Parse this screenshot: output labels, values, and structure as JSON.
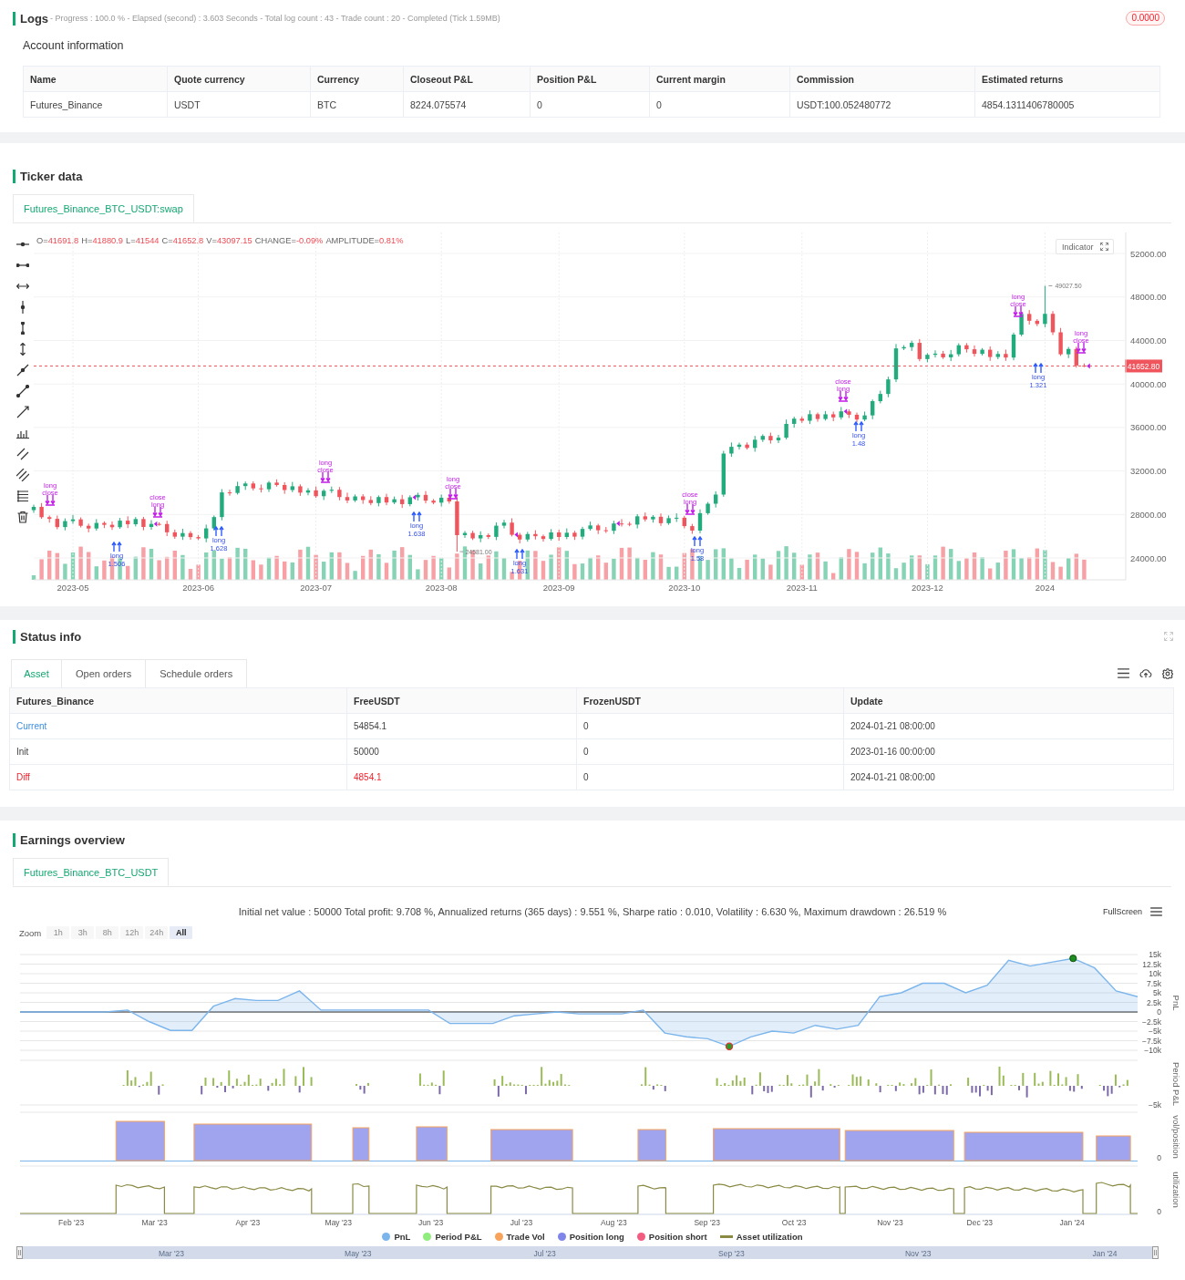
{
  "logs": {
    "title": "Logs",
    "summary": "- Progress : 100.0 % - Elapsed (second) : 3.603 Seconds - Total log count : 43 - Trade count : 20 - Completed (Tick 1.59MB)",
    "badge": "0.0000"
  },
  "account": {
    "title": "Account information",
    "columns": [
      "Name",
      "Quote currency",
      "Currency",
      "Closeout P&L",
      "Position P&L",
      "Current margin",
      "Commission",
      "Estimated returns"
    ],
    "rows": [
      [
        "Futures_Binance",
        "USDT",
        "BTC",
        "8224.075574",
        "0",
        "0",
        "USDT:100.052480772",
        "4854.1311406780005"
      ]
    ]
  },
  "ticker": {
    "title": "Ticker data",
    "tabs": [
      {
        "label": "Futures_Binance_BTC_USDT:swap",
        "selected": true
      }
    ],
    "ohlc_legend": [
      {
        "label": "O=",
        "value": "41691.8"
      },
      {
        "label": "H=",
        "value": "41880.9"
      },
      {
        "label": "L=",
        "value": "41544"
      },
      {
        "label": "C=",
        "value": "41652.8"
      },
      {
        "label": "V=",
        "value": "43097.15"
      },
      {
        "label": "CHANGE=",
        "value": "-0.09%"
      },
      {
        "label": "AMPLITUDE=",
        "value": "0.81%"
      }
    ],
    "indicator": "Indicator",
    "last_price": "41652.80",
    "high_label": "49027.50",
    "low_label": "24581.00",
    "chart_data": {
      "type": "candlestick",
      "grid": true,
      "categories": [
        null,
        null,
        null,
        null,
        null,
        "2023-05",
        null,
        null,
        null,
        null,
        null,
        null,
        null,
        null,
        null,
        null,
        null,
        null,
        null,
        null,
        null,
        "2023-06",
        null,
        null,
        null,
        null,
        null,
        null,
        null,
        null,
        null,
        null,
        null,
        null,
        null,
        null,
        "2023-07",
        null,
        null,
        null,
        null,
        null,
        null,
        null,
        null,
        null,
        null,
        null,
        null,
        null,
        null,
        null,
        "2023-08",
        null,
        null,
        null,
        null,
        null,
        null,
        null,
        null,
        null,
        null,
        null,
        null,
        null,
        null,
        "2023-09",
        null,
        null,
        null,
        null,
        null,
        null,
        null,
        null,
        null,
        null,
        null,
        null,
        null,
        null,
        null,
        "2023-10",
        null,
        null,
        null,
        null,
        null,
        null,
        null,
        null,
        null,
        null,
        null,
        null,
        null,
        null,
        "2023-11",
        null,
        null,
        null,
        null,
        null,
        null,
        null,
        null,
        null,
        null,
        null,
        null,
        null,
        null,
        null,
        "2023-12",
        null,
        null,
        null,
        null,
        null,
        null,
        null,
        null,
        null,
        null,
        null,
        null,
        null,
        null,
        "2024",
        null,
        null,
        null,
        null,
        null
      ],
      "ohlc": [
        [
          28400,
          28900,
          28150,
          28700
        ],
        [
          28700,
          29050,
          27600,
          27750
        ],
        [
          27750,
          27900,
          27250,
          27600
        ],
        [
          27600,
          27900,
          26640,
          26840
        ],
        [
          26840,
          27640,
          26540,
          27390
        ],
        [
          27390,
          27950,
          27140,
          27550
        ],
        [
          27550,
          27730,
          26810,
          26960
        ],
        [
          26960,
          27160,
          26360,
          26710
        ],
        [
          26710,
          27570,
          26510,
          27220
        ],
        [
          27220,
          27370,
          26750,
          27050
        ],
        [
          27050,
          27350,
          26580,
          26830
        ],
        [
          26830,
          27680,
          26680,
          27430
        ],
        [
          27430,
          27830,
          26750,
          27100
        ],
        [
          27100,
          27760,
          26900,
          27580
        ],
        [
          27580,
          27780,
          26550,
          26850
        ],
        [
          26850,
          27480,
          26600,
          27130
        ],
        [
          27130,
          27280,
          26970,
          27120
        ],
        [
          27120,
          27420,
          26010,
          26360
        ],
        [
          26360,
          26610,
          25760,
          25960
        ],
        [
          25960,
          26690,
          25660,
          26290
        ],
        [
          26290,
          26470,
          25670,
          25920
        ],
        [
          25920,
          26120,
          25650,
          25800
        ],
        [
          25800,
          27070,
          25450,
          26720
        ],
        [
          26720,
          27910,
          26520,
          27760
        ],
        [
          27760,
          30330,
          27460,
          30030
        ],
        [
          30030,
          30280,
          29730,
          29980
        ],
        [
          29980,
          31010,
          29830,
          30610
        ],
        [
          30610,
          31030,
          30260,
          30850
        ],
        [
          30850,
          31050,
          30200,
          30400
        ],
        [
          30400,
          30750,
          30020,
          30320
        ],
        [
          30320,
          31080,
          30070,
          30930
        ],
        [
          30930,
          31230,
          30560,
          30710
        ],
        [
          30710,
          30960,
          29900,
          30250
        ],
        [
          30250,
          30990,
          30050,
          30590
        ],
        [
          30590,
          30770,
          29710,
          30010
        ],
        [
          30010,
          30420,
          29760,
          30220
        ],
        [
          30220,
          30570,
          29530,
          29680
        ],
        [
          29680,
          30330,
          29330,
          30180
        ],
        [
          30180,
          30570,
          29980,
          30270
        ],
        [
          30270,
          30520,
          29300,
          29600
        ],
        [
          29600,
          30000,
          29040,
          29290
        ],
        [
          29290,
          29840,
          29140,
          29660
        ],
        [
          29660,
          29860,
          28980,
          29330
        ],
        [
          29330,
          29680,
          28850,
          29050
        ],
        [
          29050,
          29750,
          28750,
          29600
        ],
        [
          29600,
          29900,
          28850,
          29100
        ],
        [
          29100,
          29650,
          28950,
          29400
        ],
        [
          29400,
          29800,
          28600,
          28950
        ],
        [
          28950,
          29760,
          28750,
          29580
        ],
        [
          29580,
          30000,
          29280,
          29800
        ],
        [
          29800,
          30150,
          29020,
          29270
        ],
        [
          29270,
          29420,
          28940,
          29090
        ],
        [
          29090,
          29840,
          28740,
          29540
        ],
        [
          29540,
          29790,
          29000,
          29200
        ],
        [
          29200,
          29600,
          24581,
          26100
        ],
        [
          26100,
          26480,
          25850,
          26300
        ],
        [
          26300,
          26500,
          25650,
          25800
        ],
        [
          25800,
          26450,
          25450,
          26100
        ],
        [
          26100,
          26250,
          25740,
          25940
        ],
        [
          25940,
          27270,
          25640,
          26970
        ],
        [
          26970,
          27500,
          26720,
          27250
        ],
        [
          27250,
          27650,
          25980,
          26130
        ],
        [
          26130,
          26310,
          25350,
          25700
        ],
        [
          25700,
          26400,
          25500,
          26200
        ],
        [
          26200,
          26550,
          25700,
          26000
        ],
        [
          26000,
          26150,
          25500,
          25750
        ],
        [
          25750,
          26650,
          25600,
          26350
        ],
        [
          26350,
          26600,
          25580,
          25930
        ],
        [
          25930,
          26720,
          25730,
          26320
        ],
        [
          26320,
          26500,
          25660,
          25960
        ],
        [
          25960,
          26870,
          25710,
          26670
        ],
        [
          26670,
          27340,
          26520,
          26990
        ],
        [
          26990,
          27140,
          26200,
          26550
        ],
        [
          26550,
          26850,
          26300,
          26500
        ],
        [
          26500,
          27420,
          26200,
          27170
        ],
        [
          27170,
          27570,
          26890,
          27140
        ],
        [
          27140,
          27320,
          26920,
          27070
        ],
        [
          27070,
          28030,
          26720,
          27830
        ],
        [
          27830,
          28180,
          27350,
          27550
        ],
        [
          27550,
          27940,
          27250,
          27790
        ],
        [
          27790,
          28090,
          26950,
          27200
        ],
        [
          27200,
          27910,
          27050,
          27660
        ],
        [
          27660,
          28100,
          27310,
          27700
        ],
        [
          27700,
          27880,
          26730,
          26930
        ],
        [
          26930,
          27130,
          26220,
          26520
        ],
        [
          26520,
          28470,
          26270,
          28120
        ],
        [
          28120,
          29140,
          27970,
          28990
        ],
        [
          28990,
          30130,
          28640,
          29830
        ],
        [
          29830,
          33850,
          29630,
          33600
        ],
        [
          33600,
          34620,
          33300,
          34220
        ],
        [
          34220,
          34600,
          33970,
          34420
        ],
        [
          34420,
          34620,
          33970,
          34120
        ],
        [
          34120,
          35220,
          33770,
          34870
        ],
        [
          34870,
          35370,
          34670,
          35220
        ],
        [
          35220,
          35520,
          34520,
          34820
        ],
        [
          34820,
          35310,
          34570,
          35060
        ],
        [
          35060,
          36730,
          34910,
          36330
        ],
        [
          36330,
          36990,
          35980,
          36810
        ],
        [
          36810,
          37010,
          36420,
          36620
        ],
        [
          36620,
          37570,
          36320,
          37220
        ],
        [
          37220,
          37370,
          36530,
          36780
        ],
        [
          36780,
          37510,
          36630,
          37210
        ],
        [
          37210,
          37460,
          36580,
          36930
        ],
        [
          36930,
          37880,
          36730,
          37480
        ],
        [
          37480,
          37660,
          36870,
          37170
        ],
        [
          37170,
          37370,
          36480,
          36730
        ],
        [
          36730,
          37460,
          36580,
          37110
        ],
        [
          37110,
          38570,
          36760,
          38420
        ],
        [
          38420,
          39380,
          38220,
          39080
        ],
        [
          39080,
          40670,
          38780,
          40420
        ],
        [
          40420,
          43670,
          40170,
          43270
        ],
        [
          43270,
          43570,
          43120,
          43390
        ],
        [
          43390,
          43980,
          43040,
          43780
        ],
        [
          43780,
          44130,
          42090,
          42290
        ],
        [
          42290,
          42830,
          41990,
          42680
        ],
        [
          42680,
          43090,
          42430,
          42790
        ],
        [
          42790,
          43040,
          42300,
          42450
        ],
        [
          42450,
          43130,
          42100,
          42730
        ],
        [
          42730,
          43740,
          42530,
          43560
        ],
        [
          43560,
          43760,
          42890,
          43190
        ],
        [
          43190,
          43540,
          42520,
          42770
        ],
        [
          42770,
          43300,
          42620,
          43150
        ],
        [
          43150,
          43450,
          42130,
          42480
        ],
        [
          42480,
          43010,
          42280,
          42760
        ],
        [
          42760,
          43160,
          42130,
          42430
        ],
        [
          42430,
          44720,
          42180,
          44540
        ],
        [
          44540,
          46640,
          44390,
          46440
        ],
        [
          46440,
          46790,
          45460,
          45810
        ],
        [
          45810,
          45960,
          45320,
          45520
        ],
        [
          45520,
          49027.5,
          45220,
          46450
        ],
        [
          46450,
          46700,
          44500,
          44750
        ],
        [
          44750,
          45150,
          42580,
          42730
        ],
        [
          42730,
          43400,
          42380,
          43220
        ],
        [
          43220,
          43420,
          41500,
          41700
        ],
        [
          41691.8,
          41880.9,
          41544,
          41652.8
        ]
      ],
      "ylim": [
        21990,
        53930
      ],
      "yticks": [
        {
          "value": 52000,
          "label": "52000.00"
        },
        {
          "value": 48000,
          "label": "48000.00"
        },
        {
          "value": 44000,
          "label": "44000.00"
        },
        {
          "value": 40000,
          "label": "40000.00"
        },
        {
          "value": 36000,
          "label": "36000.00"
        },
        {
          "value": 32000,
          "label": "32000.00"
        },
        {
          "value": 28000,
          "label": "28000.00"
        },
        {
          "value": 24000,
          "label": "24000.00"
        }
      ]
    },
    "markers": [
      {
        "kind": "exit",
        "lines": [
          "long",
          "close"
        ]
      },
      {
        "kind": "entry",
        "lines": [
          "long",
          "1.506"
        ]
      },
      {
        "kind": "exit",
        "lines": [
          "close",
          "long"
        ]
      },
      {
        "kind": "entry",
        "lines": [
          "long",
          "1.628"
        ]
      },
      {
        "kind": "exit",
        "lines": [
          "long",
          "close"
        ]
      },
      {
        "kind": "entry",
        "lines": [
          "long",
          "1.638"
        ]
      },
      {
        "kind": "exit",
        "lines": [
          "long",
          "close"
        ]
      },
      {
        "kind": "entry",
        "lines": [
          "long",
          "1.631"
        ]
      },
      {
        "kind": "exit",
        "lines": [
          "close",
          "long"
        ]
      },
      {
        "kind": "entry",
        "lines": [
          "long",
          "1.58"
        ]
      },
      {
        "kind": "exit",
        "lines": [
          "close",
          "long"
        ]
      },
      {
        "kind": "entry",
        "lines": [
          "long",
          "1.48"
        ]
      },
      {
        "kind": "exit",
        "lines": [
          "long",
          "close"
        ]
      },
      {
        "kind": "entry",
        "lines": [
          "long",
          "1.321"
        ]
      },
      {
        "kind": "exit",
        "lines": [
          "long",
          "close"
        ]
      }
    ]
  },
  "status": {
    "title": "Status info",
    "tabs": [
      {
        "label": "Asset",
        "selected": true
      },
      {
        "label": "Open orders",
        "selected": false
      },
      {
        "label": "Schedule orders",
        "selected": false
      }
    ],
    "columns": [
      "Futures_Binance",
      "FreeUSDT",
      "FrozenUSDT",
      "Update"
    ],
    "rows": [
      {
        "kind": "current",
        "cells": [
          "Current",
          "54854.1",
          "0",
          "2024-01-21 08:00:00"
        ]
      },
      {
        "kind": "init",
        "cells": [
          "Init",
          "50000",
          "0",
          "2023-01-16 00:00:00"
        ]
      },
      {
        "kind": "diff",
        "cells": [
          "Diff",
          "4854.1",
          "0",
          "2024-01-21 08:00:00"
        ]
      }
    ]
  },
  "earnings": {
    "title": "Earnings overview",
    "tabs": [
      {
        "label": "Futures_Binance_BTC_USDT",
        "selected": true
      }
    ],
    "summary": "Initial net value : 50000 Total profit: 9.708 %, Annualized returns (365 days) : 9.551 %, Sharpe ratio : 0.010, Volatility : 6.630 %, Maximum drawdown : 26.519 %",
    "fullscreen": "FullScreen",
    "zoom": {
      "label": "Zoom",
      "buttons": [
        {
          "label": "1h",
          "selected": false,
          "disabled": true
        },
        {
          "label": "3h",
          "selected": false,
          "disabled": true
        },
        {
          "label": "8h",
          "selected": false,
          "disabled": true
        },
        {
          "label": "12h",
          "selected": false,
          "disabled": true
        },
        {
          "label": "24h",
          "selected": false,
          "disabled": true
        },
        {
          "label": "All",
          "selected": true,
          "disabled": false
        }
      ]
    },
    "pnl": {
      "chart_data": {
        "type": "area",
        "ylabel": "PnL",
        "grid": true,
        "values": [
          0,
          0,
          0,
          0,
          0,
          500,
          -2500,
          -4800,
          -4800,
          1500,
          3500,
          3000,
          3000,
          5500,
          500,
          500,
          500,
          500,
          500,
          500,
          -3000,
          -3000,
          -3000,
          -1000,
          -500,
          0,
          -500,
          -500,
          -500,
          500,
          -5500,
          -6500,
          -7000,
          -9000,
          -6500,
          -5000,
          -5500,
          -3500,
          -4500,
          -3500,
          4000,
          5000,
          7500,
          7500,
          5000,
          7000,
          13500,
          12000,
          13000,
          14000,
          11500,
          5500,
          4000
        ],
        "ylim": [
          -10000,
          15000
        ],
        "yticks": [
          {
            "value": 15000,
            "label": "15k"
          },
          {
            "value": 12500,
            "label": "12.5k"
          },
          {
            "value": 10000,
            "label": "10k"
          },
          {
            "value": 7500,
            "label": "7.5k"
          },
          {
            "value": 5000,
            "label": "5k"
          },
          {
            "value": 2500,
            "label": "2.5k"
          },
          {
            "value": 0,
            "label": "0"
          },
          {
            "value": -2500,
            "label": "−2.5k"
          },
          {
            "value": -5000,
            "label": "−5k"
          },
          {
            "value": -7500,
            "label": "−7.5k"
          },
          {
            "value": -10000,
            "label": "−10k"
          }
        ]
      }
    },
    "period_pnl": {
      "axis_title": "Period P&L",
      "tick": "−5k"
    },
    "position": {
      "axis_title": "vol/position",
      "tick": "0"
    },
    "utilization": {
      "axis_title": "utilization",
      "tick": "0"
    },
    "time_axis": [
      "Feb '23",
      "Mar '23",
      "Apr '23",
      "May '23",
      "Jun '23",
      "Jul '23",
      "Aug '23",
      "Sep '23",
      "Oct '23",
      "Nov '23",
      "Dec '23",
      "Jan '24"
    ],
    "legend": [
      {
        "label": "PnL",
        "color": "#7cb5ec",
        "kind": "dot"
      },
      {
        "label": "Period P&L",
        "color": "#90ed7d",
        "kind": "dot"
      },
      {
        "label": "Trade Vol",
        "color": "#f7a35c",
        "kind": "dot"
      },
      {
        "label": "Position long",
        "color": "#8085e9",
        "kind": "dot"
      },
      {
        "label": "Position short",
        "color": "#f15c80",
        "kind": "dot"
      },
      {
        "label": "Asset utilization",
        "color": "#8a8a45",
        "kind": "line"
      }
    ],
    "navigator": [
      "Mar '23",
      "May '23",
      "Jul '23",
      "Sep '23",
      "Nov '23",
      "Jan '24"
    ]
  }
}
